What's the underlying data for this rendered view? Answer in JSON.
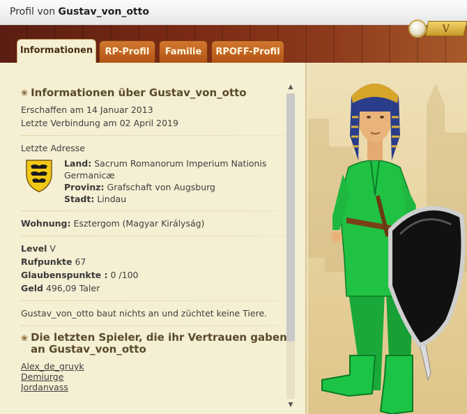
{
  "window": {
    "title_prefix": "Profil von",
    "title_name": "Gustav_von_otto"
  },
  "header": {
    "level_badge": "V",
    "coin_icon": "coin-icon"
  },
  "tabs": [
    {
      "label": "Informationen",
      "active": true
    },
    {
      "label": "RP-Profil",
      "active": false
    },
    {
      "label": "Familie",
      "active": false
    },
    {
      "label": "RPOFF-Profil",
      "active": false
    }
  ],
  "info": {
    "section_title": "Informationen über Gustav_von_otto",
    "created": "Erschaffen am 14 Januar 2013",
    "last_login": "Letzte Verbindung am 02 April 2019",
    "address_heading": "Letzte Adresse",
    "land_label": "Land:",
    "land_value": "Sacrum Romanorum Imperium Nationis Germanicæ",
    "province_label": "Provinz:",
    "province_value": "Grafschaft von Augsburg",
    "city_label": "Stadt:",
    "city_value": "Lindau",
    "residence_label": "Wohnung:",
    "residence_value": "Esztergom (Magyar Királyság)",
    "level_label": "Level",
    "level_value": "V",
    "fame_label": "Rufpunkte",
    "fame_value": "67",
    "faith_label": "Glaubenspunkte :",
    "faith_value": "0 /100",
    "money_label": "Geld",
    "money_value": "496,09 Taler",
    "activity": "Gustav_von_otto baut nichts an und züchtet keine Tiere."
  },
  "trust": {
    "section_title": "Die letzten Spieler, die ihr Vertrauen gaben an Gustav_von_otto",
    "players": [
      "Alex_de_gruyk",
      "Demiurge",
      "Jordanvass"
    ]
  },
  "colors": {
    "tab_active_bg": "#f5efd3",
    "tab_inactive_bg": "#c4651f",
    "header_bg": "#6e2614",
    "character_outfit": "#1fb83f"
  }
}
